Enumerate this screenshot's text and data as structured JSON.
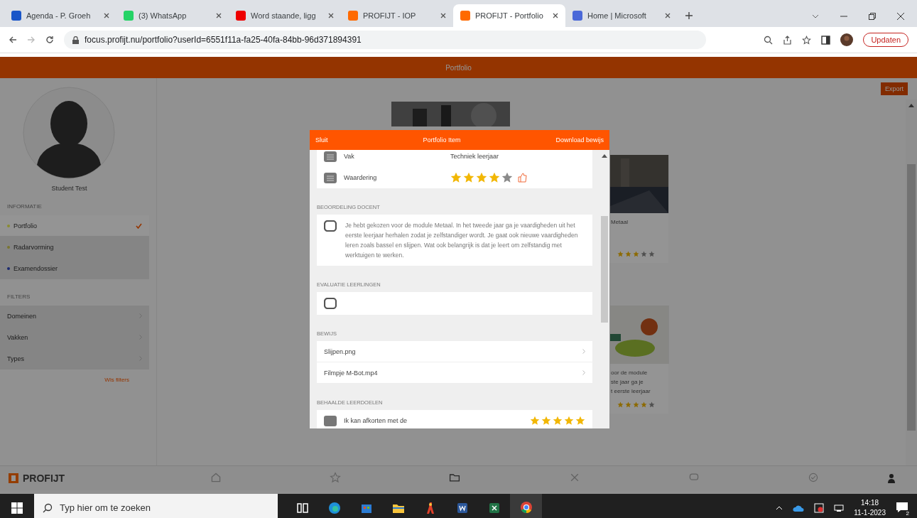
{
  "browser": {
    "tabs": [
      {
        "title": "Agenda - P. Groeh",
        "kind": "agenda",
        "selected": false
      },
      {
        "title": "(3) WhatsApp",
        "kind": "whatsapp",
        "selected": false
      },
      {
        "title": "Word staande, ligg",
        "kind": "youtube",
        "selected": false
      },
      {
        "title": "PROFIJT - IOP",
        "kind": "profijt",
        "selected": false
      },
      {
        "title": "PROFIJT - Portfolio",
        "kind": "profijt",
        "selected": true
      },
      {
        "title": "Home | Microsoft",
        "kind": "microsoft",
        "selected": false
      }
    ],
    "url": "focus.profijt.nu/portfolio?userId=6551f11a-fa25-40fa-84bb-96d371894391",
    "update_button": "Updaten"
  },
  "app": {
    "header_title": "Portfolio",
    "export_button": "Export",
    "sidebar": {
      "name": "Student Test",
      "sections": [
        {
          "heading": "INFORMATIE",
          "items": [
            {
              "label": "Portfolio",
              "color": "#8a8c30",
              "selected": true
            },
            {
              "label": "Radarvorming",
              "color": "#7a7630",
              "selected": false
            },
            {
              "label": "Examendossier",
              "color": "#1c2a70",
              "selected": false
            }
          ]
        },
        {
          "heading": "FILTERS",
          "items": [
            {
              "label": "Domeinen",
              "selected": false
            },
            {
              "label": "Vakken",
              "selected": false
            },
            {
              "label": "Types",
              "selected": false
            }
          ]
        }
      ],
      "clear_filters": "Wis filters"
    },
    "cards": [
      {
        "kind": "picture"
      },
      {
        "lines": [
          "Metaal"
        ],
        "stars": 3
      },
      {
        "lines": [
          "oor de module",
          "ste jaar ga je",
          "t eerste leerjaar"
        ],
        "stars": 4
      }
    ],
    "modal": {
      "close": "Sluit",
      "title": "Portfolio Item",
      "download": "Download bewijs",
      "fields": [
        {
          "label": "Vak",
          "value": "Techniek leerjaar"
        },
        {
          "label": "Waardering",
          "stars": 4
        }
      ],
      "sections": [
        {
          "heading": "BEOORDELING DOCENT",
          "kind": "comment",
          "text": "Je hebt gekozen voor de module Metaal. In het tweede jaar ga je vaardigheden uit het eerste leerjaar herhalen zodat je zelfstandiger wordt. Je gaat ook nieuwe vaardigheden leren zoals bassel en slijpen. Wat ook belangrijk is dat je leert om zelfstandig met werktuigen te werken."
        },
        {
          "heading": "EVALUATIE LEERLINGEN",
          "kind": "comment"
        },
        {
          "heading": "BEWIJS",
          "kind": "files",
          "files": [
            "Slijpen.png",
            "Filmpje M-Bot.mp4"
          ]
        },
        {
          "heading": "BEHAALDE LEERDOELEN",
          "kind": "goals",
          "goals": [
            {
              "text": "Ik kan afkorten met de",
              "stars": 5
            }
          ]
        }
      ]
    },
    "bottom_nav": {
      "logo": "PROFIJT",
      "items": [
        {
          "kind": "home",
          "selected": false
        },
        {
          "kind": "star",
          "selected": false
        },
        {
          "kind": "folder",
          "selected": true
        },
        {
          "kind": "tools",
          "selected": false
        },
        {
          "kind": "chat",
          "selected": false
        },
        {
          "kind": "check",
          "selected": false
        }
      ]
    }
  },
  "taskbar": {
    "search_placeholder": "Typ hier om te zoeken",
    "apps": [
      {
        "kind": "taskview",
        "active": false
      },
      {
        "kind": "edge",
        "active": false
      },
      {
        "kind": "store",
        "active": false
      },
      {
        "kind": "explorer",
        "active": false
      },
      {
        "kind": "paint",
        "active": false
      },
      {
        "kind": "word",
        "active": false
      },
      {
        "kind": "excel",
        "active": false
      },
      {
        "kind": "chrome",
        "active": true
      }
    ],
    "time": "14:18",
    "date": "11-1-2023",
    "notifications": "2"
  }
}
